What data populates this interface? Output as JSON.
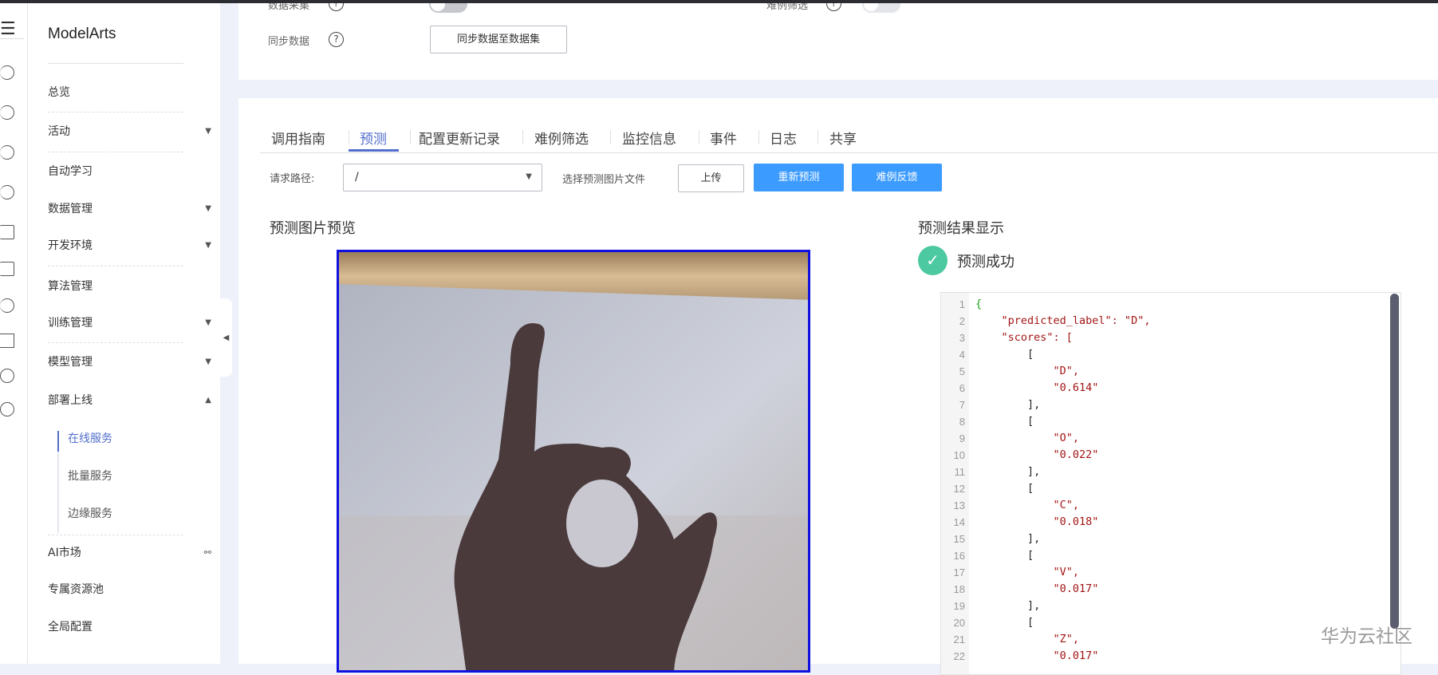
{
  "sidebar": {
    "brand": "ModelArts",
    "items": [
      {
        "label": "总览"
      },
      {
        "label": "活动"
      },
      {
        "label": "自动学习"
      },
      {
        "label": "数据管理"
      },
      {
        "label": "开发环境"
      },
      {
        "label": "算法管理"
      },
      {
        "label": "训练管理"
      },
      {
        "label": "模型管理"
      },
      {
        "label": "部署上线"
      },
      {
        "label": "AI市场"
      },
      {
        "label": "专属资源池"
      },
      {
        "label": "全局配置"
      }
    ],
    "sub_items": [
      {
        "label": "在线服务",
        "active": true
      },
      {
        "label": "批量服务"
      },
      {
        "label": "边缘服务"
      }
    ]
  },
  "config": {
    "data_collect_label": "数据采集",
    "hard_filter_label": "难例筛选",
    "sync_label": "同步数据",
    "sync_button": "同步数据至数据集",
    "help": "?"
  },
  "tabs": [
    {
      "label": "调用指南"
    },
    {
      "label": "预测",
      "active": true
    },
    {
      "label": "配置更新记录"
    },
    {
      "label": "难例筛选"
    },
    {
      "label": "监控信息"
    },
    {
      "label": "事件"
    },
    {
      "label": "日志"
    },
    {
      "label": "共享"
    }
  ],
  "predict": {
    "path_label": "请求路径:",
    "path_value": "/",
    "file_label": "选择预测图片文件",
    "upload": "上传",
    "repredict": "重新预测",
    "feedback": "难例反馈",
    "preview_title": "预测图片预览",
    "result_title": "预测结果显示",
    "status": "预测成功",
    "code_lines": [
      "{",
      "    \"predicted_label\": \"D\",",
      "    \"scores\": [",
      "        [",
      "            \"D\",",
      "            \"0.614\"",
      "        ],",
      "        [",
      "            \"O\",",
      "            \"0.022\"",
      "        ],",
      "        [",
      "            \"C\",",
      "            \"0.018\"",
      "        ],",
      "        [",
      "            \"V\",",
      "            \"0.017\"",
      "        ],",
      "        [",
      "            \"Z\",",
      "            \"0.017\""
    ]
  },
  "watermark": "华为云社区",
  "colors": {
    "accent": "#526ecc",
    "primary": "#3c9bff",
    "success": "#4cc9a0"
  }
}
